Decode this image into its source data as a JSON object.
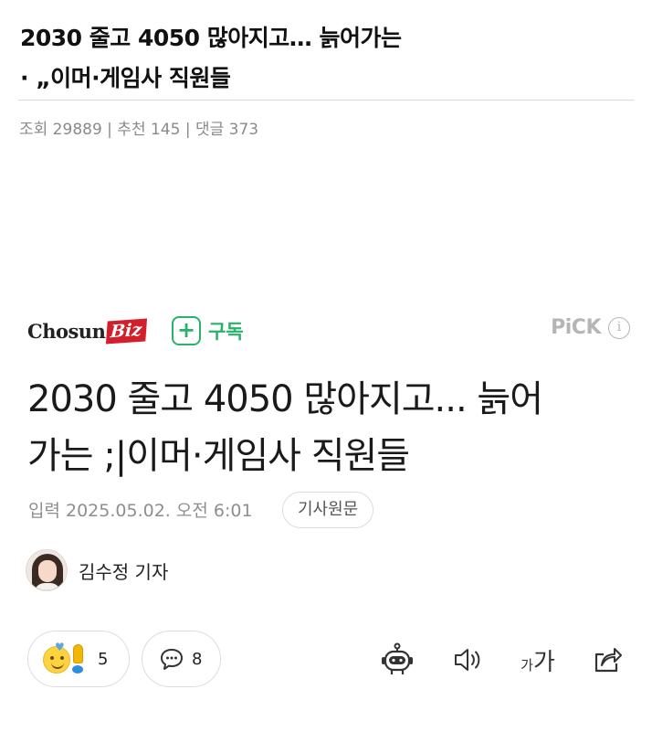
{
  "post": {
    "title_line1": "2030 줄고 4050 많아지고… 늙어가는",
    "title_line2": "· „이머·게임사 직원들",
    "meta": "조회 29889 | 추천 145 | 댓글 373"
  },
  "press": {
    "logo_main": "Chosun",
    "logo_accent": "Biz",
    "subscribe_label": "구독",
    "pick_label": "PiCK",
    "info_glyph": "i"
  },
  "article": {
    "title_line1": "2030 줄고 4050 많아지고... 늙어",
    "title_line2": "가는 ;|이머·게임사 직원들",
    "date": "입력 2025.05.02. 오전 6:01",
    "source_button": "기사원문",
    "author": "김수정 기자"
  },
  "reactions": {
    "emoji_count": "5",
    "comment_count": "8"
  },
  "toolbar": {
    "font_small": "가",
    "font_large": "가",
    "icons": [
      "robot-summary-icon",
      "speaker-icon",
      "font-size-icon",
      "share-icon"
    ]
  },
  "colors": {
    "accent_green": "#27b36a",
    "brand_red": "#d21f2b",
    "muted": "#8a8a8a"
  }
}
